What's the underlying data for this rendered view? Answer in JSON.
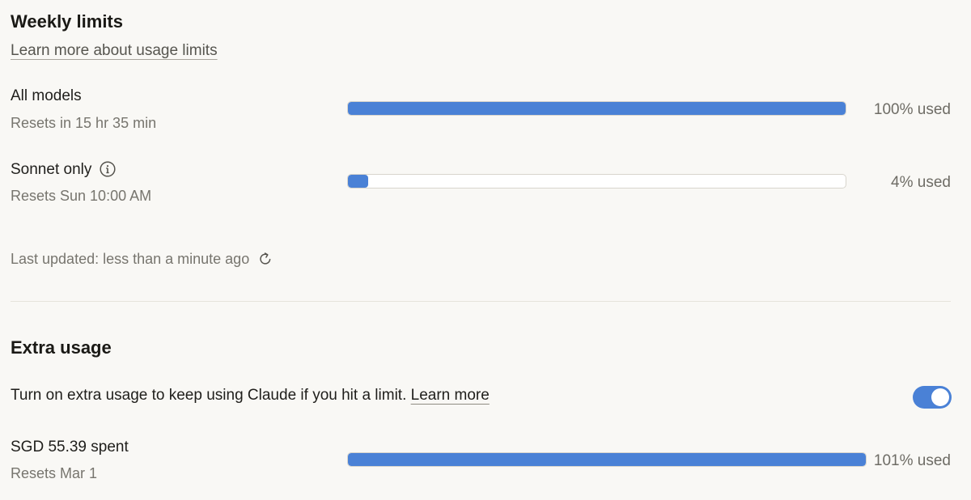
{
  "weekly_limits": {
    "title": "Weekly limits",
    "learn_more_link": "Learn more about usage limits",
    "rows": [
      {
        "label": "All models",
        "reset": "Resets in 15 hr 35 min",
        "percent_used": 100,
        "percent_text": "100% used"
      },
      {
        "label": "Sonnet only",
        "reset": "Resets Sun 10:00 AM",
        "percent_used": 4,
        "percent_text": "4% used",
        "icon": "info-icon"
      }
    ],
    "last_updated": "Last updated: less than a minute ago",
    "refresh_icon": "refresh-icon"
  },
  "extra_usage": {
    "title": "Extra usage",
    "description": "Turn on extra usage to keep using Claude if you hit a limit.",
    "learn_more_link": "Learn more",
    "toggle_on": true,
    "spent_label": "SGD 55.39 spent",
    "reset": "Resets Mar 1",
    "percent_used": 101,
    "percent_text": "101% used"
  },
  "colors": {
    "accent": "#4a81d6",
    "background": "#f9f8f5",
    "track": "#ffffff"
  }
}
